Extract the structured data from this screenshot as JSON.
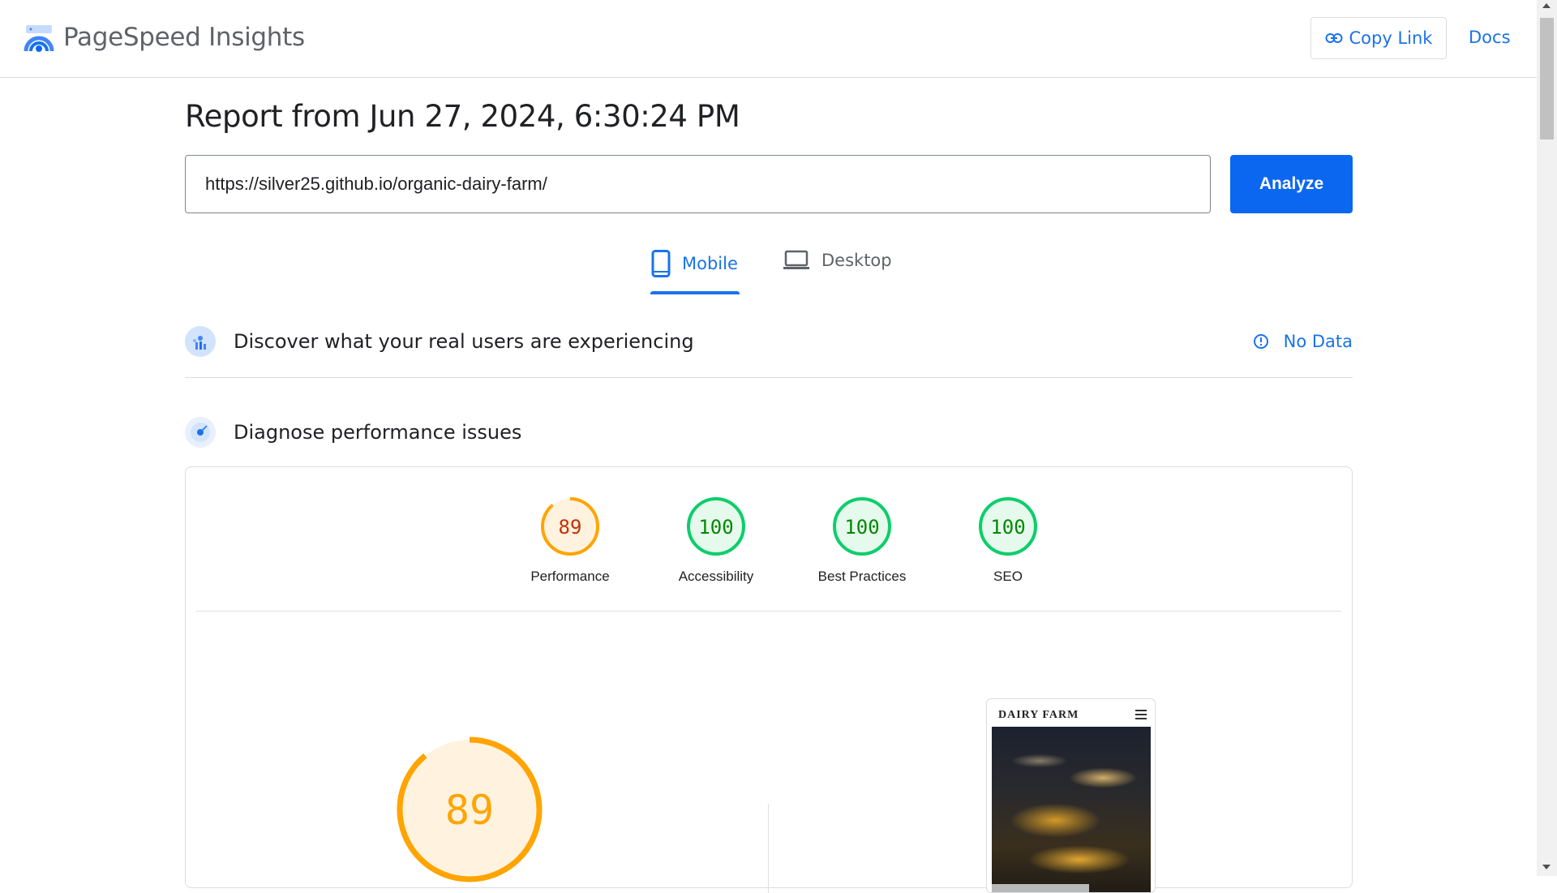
{
  "header": {
    "brand": "PageSpeed Insights",
    "copy_link": "Copy Link",
    "docs": "Docs"
  },
  "report": {
    "title": "Report from Jun 27, 2024, 6:30:24 PM",
    "url_value": "https://silver25.github.io/organic-dairy-farm/",
    "analyze": "Analyze"
  },
  "tabs": {
    "mobile": "Mobile",
    "desktop": "Desktop",
    "active": "Mobile"
  },
  "field_data": {
    "title": "Discover what your real users are experiencing",
    "status": "No Data"
  },
  "diagnose": {
    "title": "Diagnose performance issues"
  },
  "scores": [
    {
      "label": "Performance",
      "value": "89",
      "status": "average"
    },
    {
      "label": "Accessibility",
      "value": "100",
      "status": "pass"
    },
    {
      "label": "Best Practices",
      "value": "100",
      "status": "pass"
    },
    {
      "label": "SEO",
      "value": "100",
      "status": "pass"
    }
  ],
  "performance_gauge": {
    "value": "89"
  },
  "preview": {
    "site_name": "DAIRY FARM"
  },
  "colors": {
    "accent": "#1a73e8",
    "analyze_bg": "#0b67ef",
    "average": "#ffa400",
    "average_text": "#c33300",
    "pass": "#0cce6b",
    "pass_text": "#008800"
  }
}
